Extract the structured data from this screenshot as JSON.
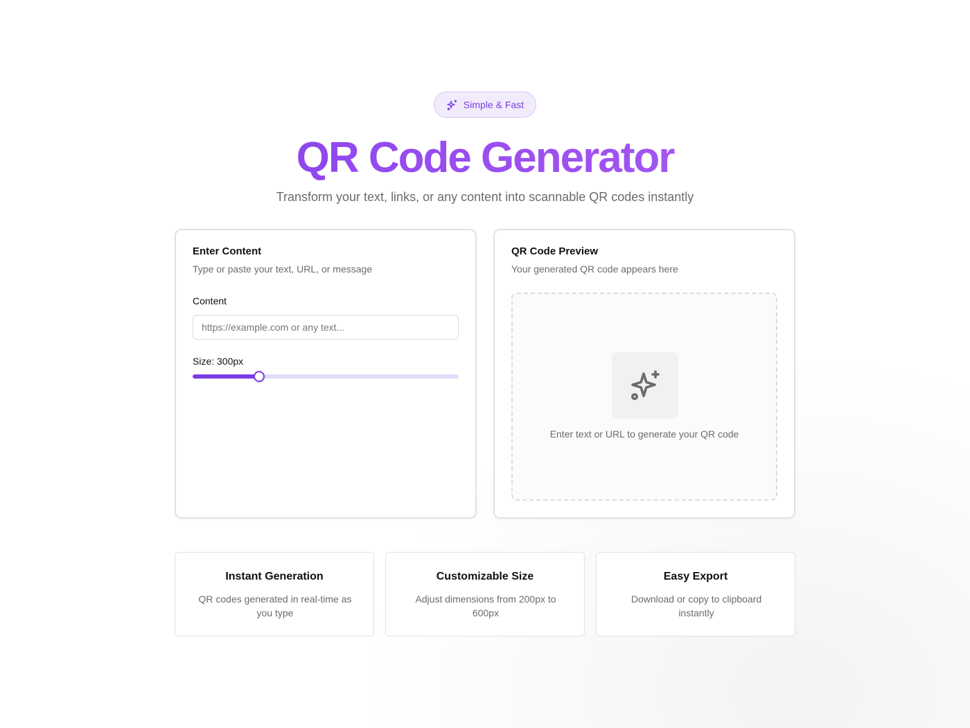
{
  "hero": {
    "badge_label": "Simple & Fast",
    "badge_icon": "sparkles-icon",
    "title": "QR Code Generator",
    "subtitle": "Transform your text, links, or any content into scannable QR codes instantly",
    "title_gradient": [
      "#7b3ce6",
      "#b160f2"
    ]
  },
  "input_card": {
    "title": "Enter Content",
    "description": "Type or paste your text, URL, or message",
    "content_label": "Content",
    "content_value": "",
    "content_placeholder": "https://example.com or any text...",
    "size_label": "Size: 300px",
    "size_min": 200,
    "size_max": 600,
    "size_value": 300
  },
  "preview_card": {
    "title": "QR Code Preview",
    "description": "Your generated QR code appears here",
    "empty_icon": "sparkles-icon",
    "empty_message": "Enter text or URL to generate your QR code"
  },
  "features": [
    {
      "title": "Instant Generation",
      "description": "QR codes generated in real-time as you type"
    },
    {
      "title": "Customizable Size",
      "description": "Adjust dimensions from 200px to 600px"
    },
    {
      "title": "Easy Export",
      "description": "Download or copy to clipboard instantly"
    }
  ],
  "colors": {
    "accent": "#7b3ce6",
    "accent_light": "#f1ebfc",
    "track": "#e3dafa"
  }
}
